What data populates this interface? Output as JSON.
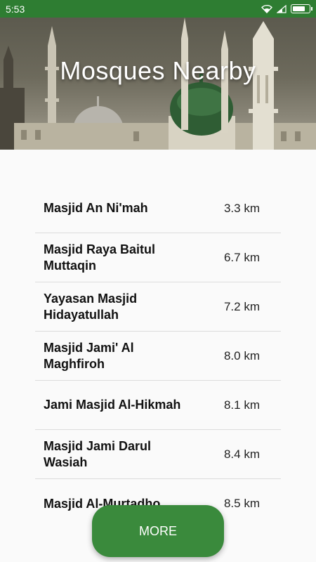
{
  "status_bar": {
    "time": "5:53",
    "icons": [
      "wifi-icon",
      "signal-icon",
      "battery-icon"
    ],
    "battery_level": 0.82
  },
  "header": {
    "title": "Mosques Nearby"
  },
  "mosques": [
    {
      "name": "Masjid An Ni'mah",
      "distance": "3.3 km"
    },
    {
      "name": "Masjid Raya Baitul Muttaqin",
      "distance": "6.7 km"
    },
    {
      "name": "Yayasan Masjid Hidayatullah",
      "distance": "7.2 km"
    },
    {
      "name": "Masjid Jami' Al Maghfiroh",
      "distance": "8.0 km"
    },
    {
      "name": "Jami Masjid Al-Hikmah",
      "distance": "8.1 km"
    },
    {
      "name": "Masjid Jami Darul Wasiah",
      "distance": "8.4 km"
    },
    {
      "name": "Masjid Al-Murtadho",
      "distance": "8.5 km"
    }
  ],
  "more_button": {
    "label": "MORE"
  },
  "colors": {
    "primary": "#2e7d32",
    "button": "#3a8a3c"
  }
}
